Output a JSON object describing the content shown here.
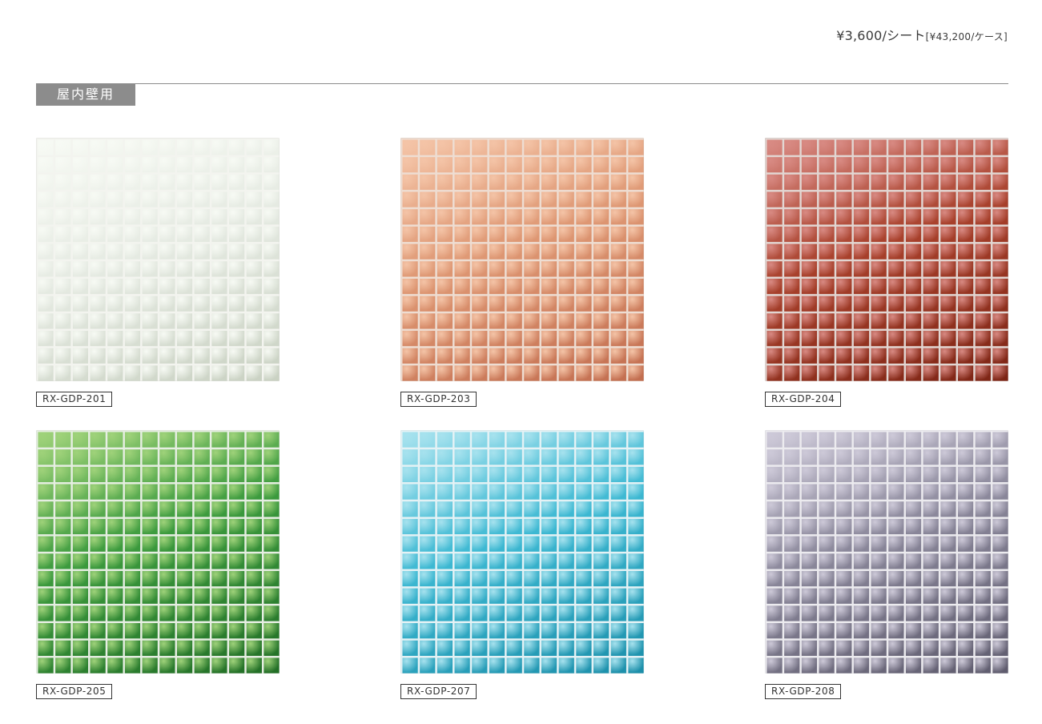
{
  "price": {
    "sheet": "¥3,600/シート",
    "case": "[¥43,200/ケース]"
  },
  "section": {
    "label": "屋内壁用"
  },
  "products": [
    {
      "code": "RX-GDP-201",
      "colors": {
        "base": "#e6ebe3",
        "light": "#f7faf4",
        "dark": "#c9d1c2",
        "grout": "#f3f4ef"
      }
    },
    {
      "code": "RX-GDP-203",
      "colors": {
        "base": "#de9773",
        "light": "#f4c4a7",
        "dark": "#c26d4f",
        "grout": "#eeddd2"
      }
    },
    {
      "code": "RX-GDP-204",
      "colors": {
        "base": "#a8402b",
        "light": "#d88a83",
        "dark": "#7c2414",
        "grout": "#e2d6d2"
      }
    },
    {
      "code": "RX-GDP-205",
      "colors": {
        "base": "#3b9a3d",
        "light": "#9fd27a",
        "dark": "#226e26",
        "grout": "#e6eee2"
      }
    },
    {
      "code": "RX-GDP-207",
      "colors": {
        "base": "#3cb8d2",
        "light": "#a7e2ee",
        "dark": "#1b8ea9",
        "grout": "#e4f2f5"
      }
    },
    {
      "code": "RX-GDP-208",
      "colors": {
        "base": "#8a879a",
        "light": "#cdc9d8",
        "dark": "#5e5b6d",
        "grout": "#ecebef"
      }
    }
  ]
}
